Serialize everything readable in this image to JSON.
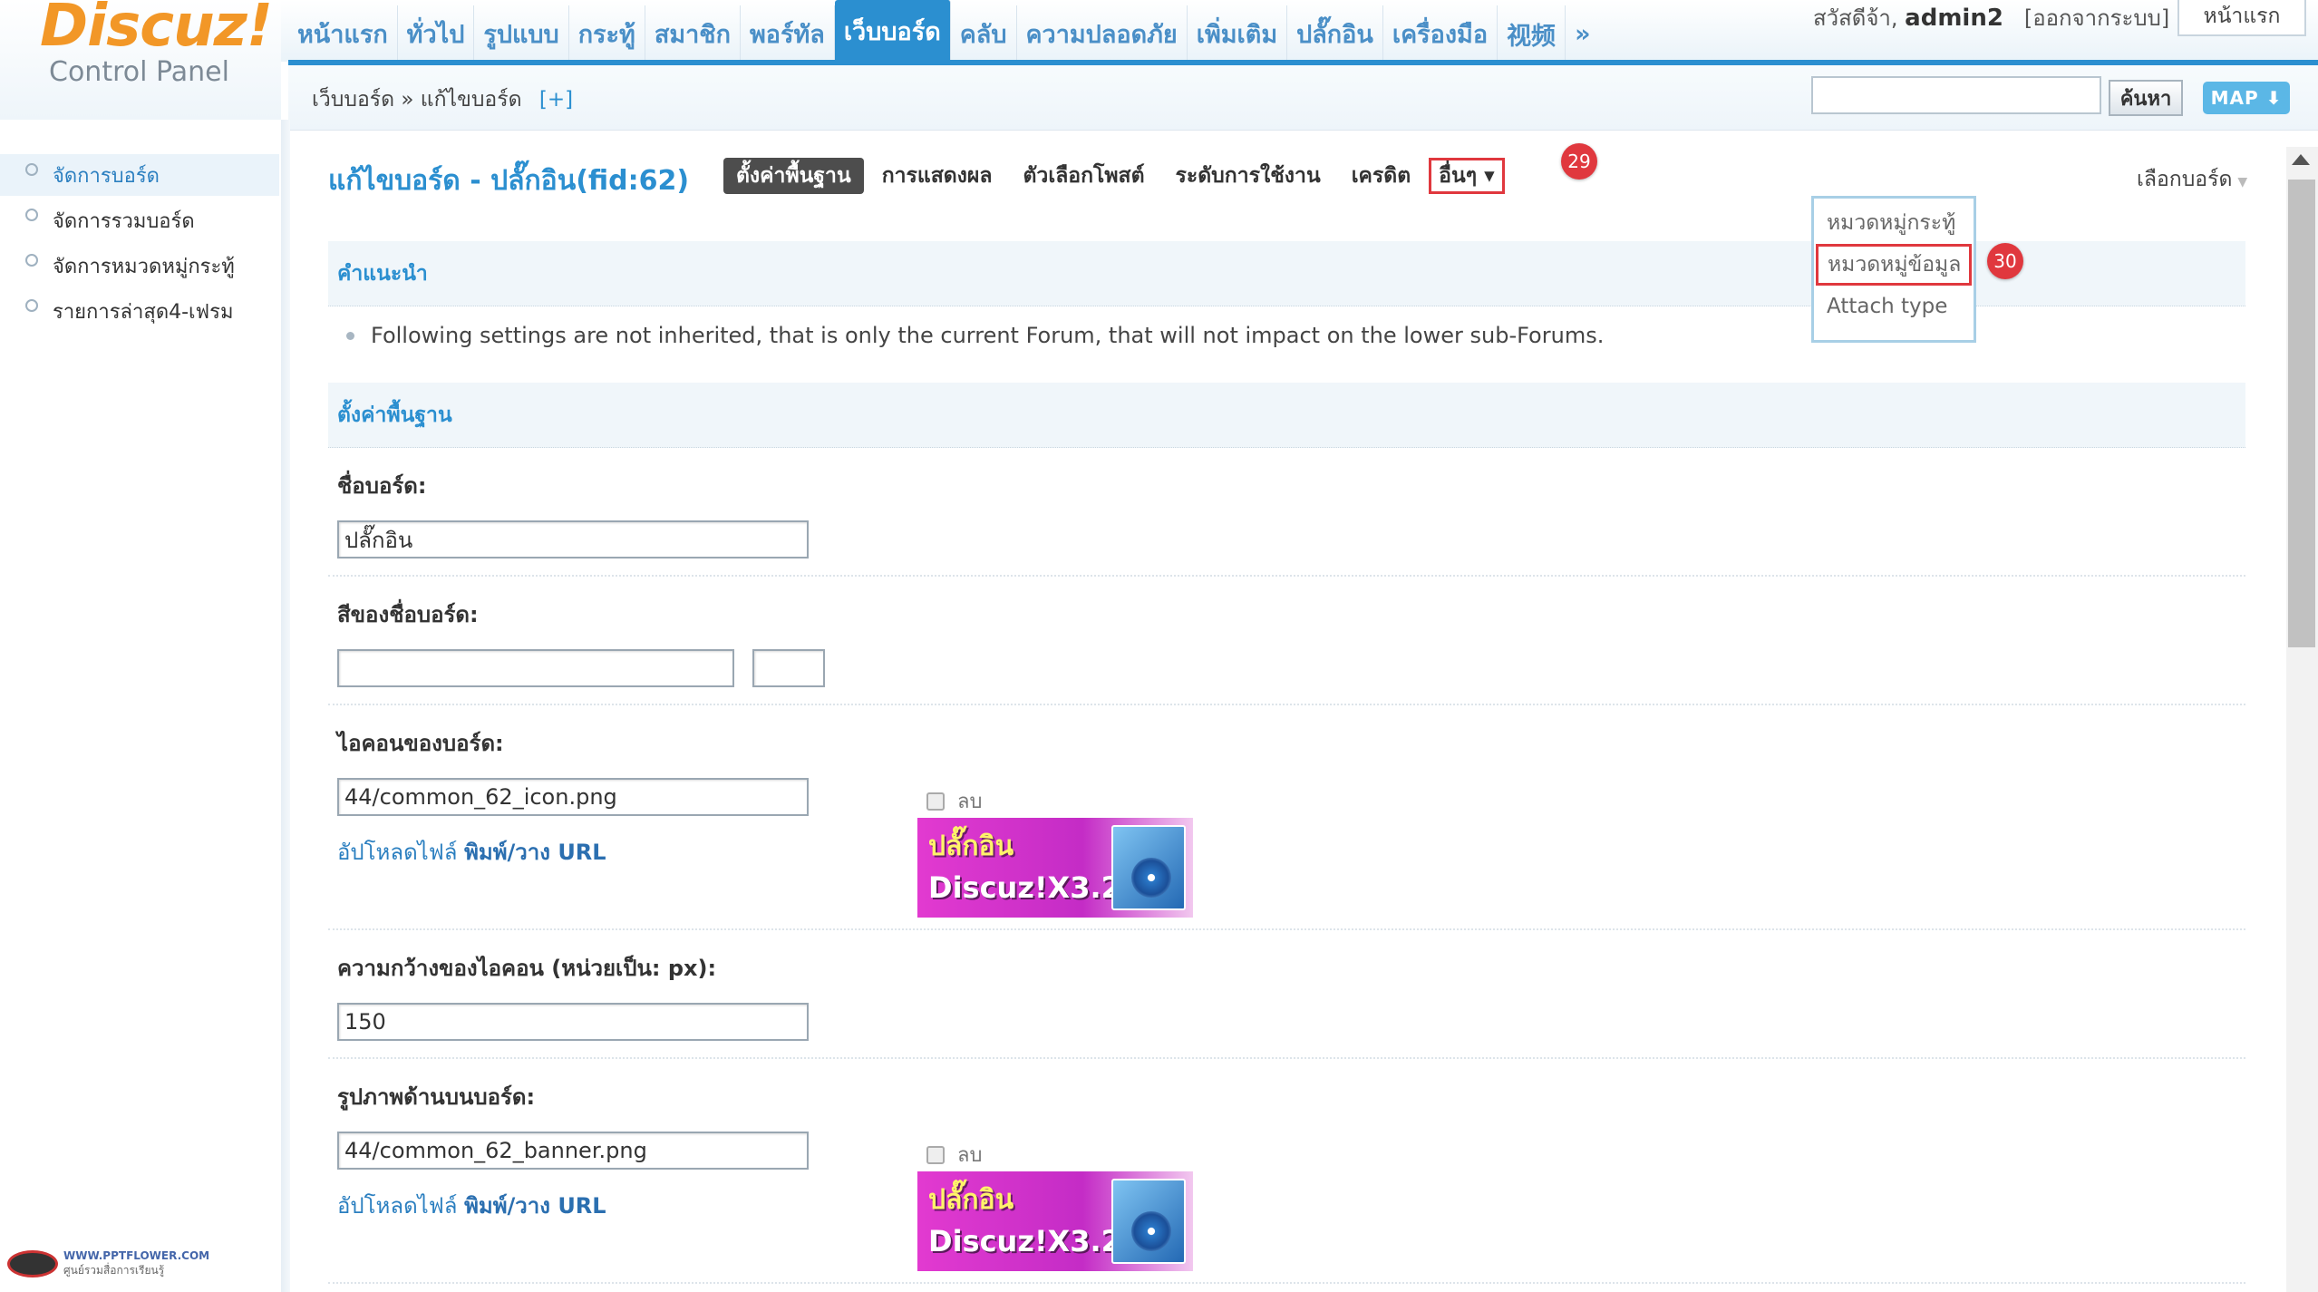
{
  "logo": {
    "title": "Discuz!",
    "subtitle": "Control Panel"
  },
  "nav": {
    "items": [
      "หน้าแรก",
      "ทั่วไป",
      "รูปแบบ",
      "กระทู้",
      "สมาชิก",
      "พอร์ทัล",
      "เว็บบอร์ด",
      "คลับ",
      "ความปลอดภัย",
      "เพิ่มเติม",
      "ปลั๊กอิน",
      "เครื่องมือ",
      "视频",
      "»"
    ],
    "active_index": 6
  },
  "user": {
    "greeting": "สวัสดีจ้า,",
    "name": "admin2",
    "logout": "[ออกจากระบบ]",
    "home": "หน้าแรก"
  },
  "subheader": {
    "breadcrumb": "เว็บบอร์ด » แก้ไขบอร์ด",
    "add": "[+]",
    "search_button": "ค้นหา",
    "map_button": "MAP ⬇"
  },
  "sidebar": {
    "items": [
      "จัดการบอร์ด",
      "จัดการรวมบอร์ด",
      "จัดการหมวดหมู่กระทู้",
      "รายการล่าสุด4-เฟรม"
    ],
    "active_index": 0
  },
  "watermark": {
    "line1": "WWW.PPTFLOWER.COM",
    "line2": "ศูนย์รวมสื่อการเรียนรู้"
  },
  "main": {
    "title": "แก้ไขบอร์ด - ปลั๊กอิน(fid:62)",
    "tabs": [
      "ตั้งค่าพื้นฐาน",
      "การแสดงผล",
      "ตัวเลือกโพสต์",
      "ระดับการใช้งาน",
      "เครดิต",
      "อื่นๆ ▾"
    ],
    "active_tab": 0,
    "choose_forum": "เลือกบอร์ด",
    "dropdown": [
      "หมวดหมู่กระทู้",
      "หมวดหมู่ข้อมูล",
      "Attach type"
    ],
    "badges": [
      "29",
      "30"
    ],
    "tips_heading": "คำแนะนำ",
    "tip_text": "Following settings are not inherited, that is only the current Forum, that will not impact on the lower sub-Forums.",
    "basic_heading": "ตั้งค่าพื้นฐาน",
    "fields": {
      "name_label": "ชื่อบอร์ด:",
      "name_value": "ปลั๊กอิน",
      "color_label": "สีของชื่อบอร์ด:",
      "color_value": "",
      "icon_label": "ไอคอนของบอร์ด:",
      "icon_value": "44/common_62_icon.png",
      "icon_width_label": "ความกว้างของไอคอน (หน่วยเป็น: px):",
      "icon_width_value": "150",
      "banner_label": "รูปภาพด้านบนบอร์ด:",
      "banner_value": "44/common_62_banner.png"
    },
    "upload_text": "อัปโหลดไฟล์",
    "paste_url": "พิมพ์/วาง URL",
    "delete_label": "ลบ",
    "plugin_image": {
      "line1": "ปลั๊กอิน",
      "line2": "Discuz!X3.2"
    }
  }
}
